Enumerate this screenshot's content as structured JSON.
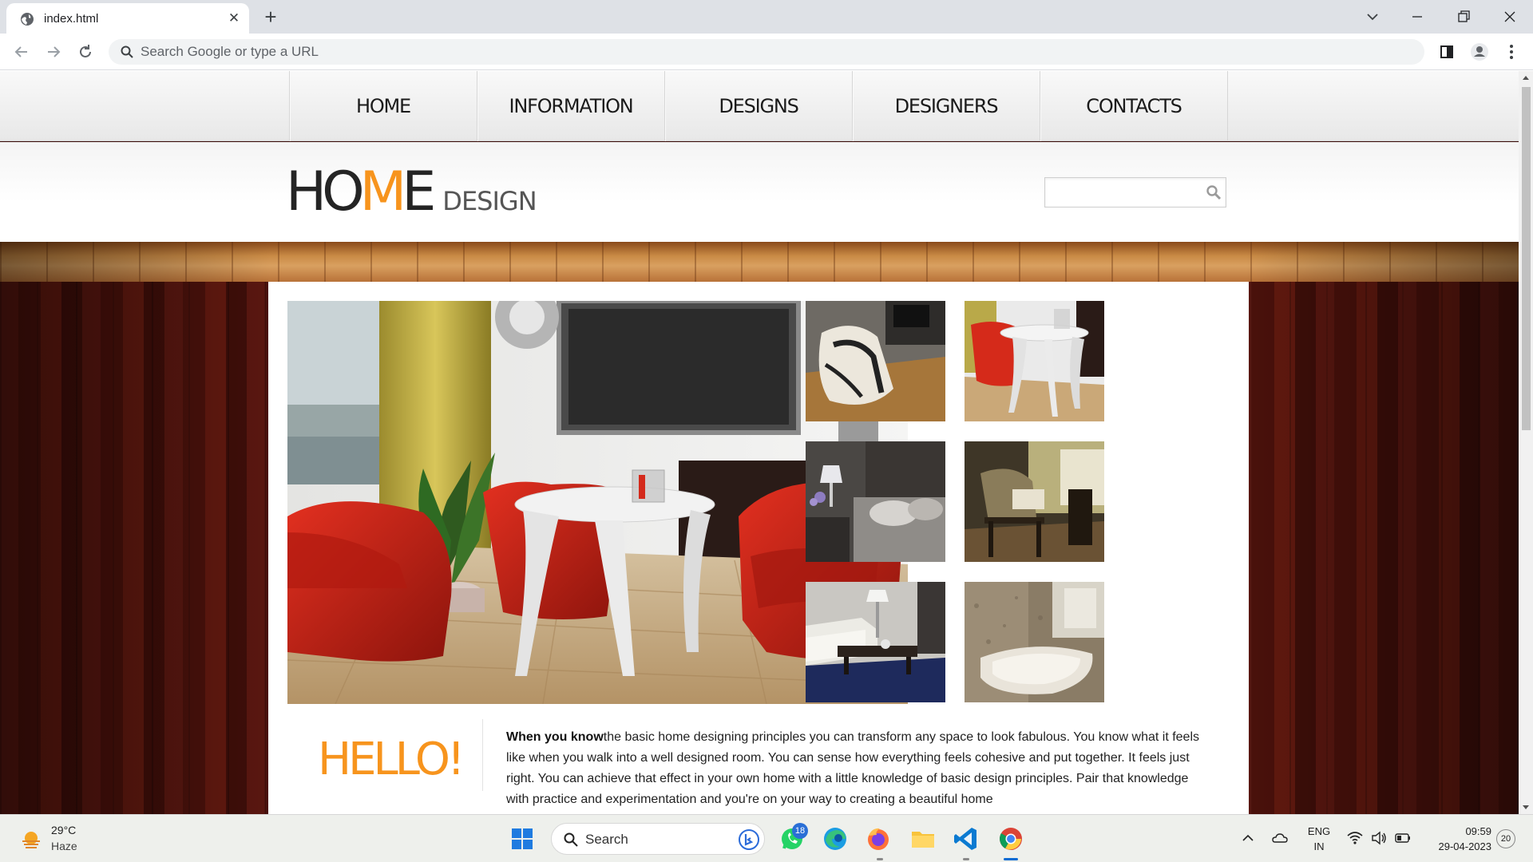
{
  "browser": {
    "tab_title": "index.html",
    "new_tab_label": "+",
    "omnibox_placeholder": "Search Google or type a URL"
  },
  "site": {
    "nav": [
      "HOME",
      "INFORMATION",
      "DESIGNS",
      "DESIGNERS",
      "CONTACTS"
    ],
    "logo": {
      "part1": "HO",
      "part2": "M",
      "part3": "E",
      "suffix": "DESIGN"
    },
    "search_placeholder": "",
    "hello": "HELLO!",
    "intro_lead": "When you know",
    "intro_text": "the basic home designing principles you can transform any space to look fabulous. You know what it feels like when you walk into a well designed room. You can sense how everything feels cohesive and put together. It feels just right. You can achieve that effect in your own home with a little knowledge of basic design principles. Pair that knowledge with practice and experimentation and you're on your way to creating a beautiful home"
  },
  "taskbar": {
    "weather_temp": "29°C",
    "weather_cond": "Haze",
    "search_label": "Search",
    "whatsapp_badge": "18",
    "lang_1": "ENG",
    "lang_2": "IN",
    "time": "09:59",
    "date": "29-04-2023",
    "notification_count": "20"
  },
  "colors": {
    "accent_orange": "#f7941d",
    "wood_dark": "#4a110b",
    "chrome_bar": "#dee1e6"
  }
}
